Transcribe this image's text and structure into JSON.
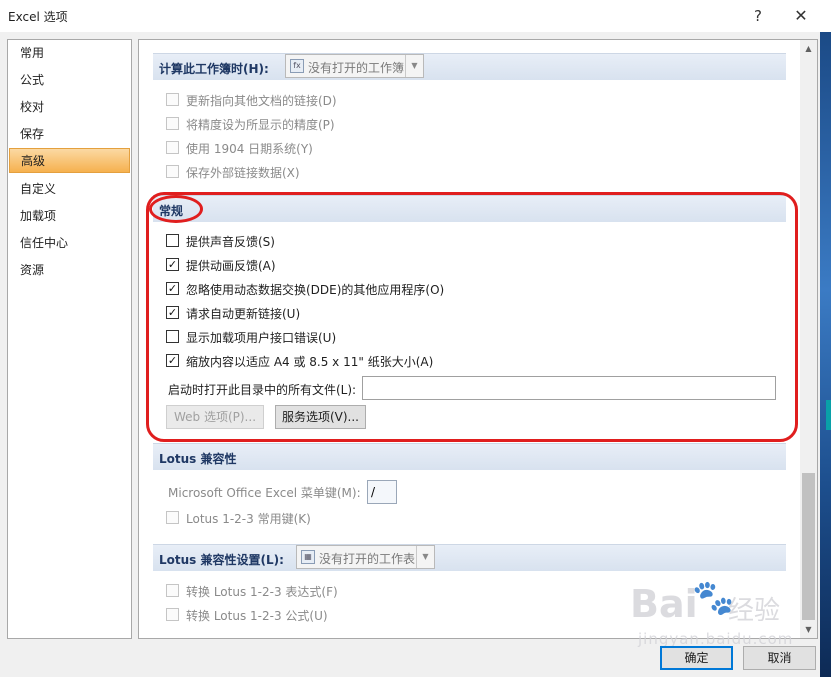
{
  "window": {
    "title": "Excel 选项",
    "help_glyph": "?",
    "close_glyph": "✕"
  },
  "nav": {
    "items": [
      {
        "label": "常用"
      },
      {
        "label": "公式"
      },
      {
        "label": "校对"
      },
      {
        "label": "保存"
      },
      {
        "label": "高级",
        "active": true
      },
      {
        "label": "自定义"
      },
      {
        "label": "加载项"
      },
      {
        "label": "信任中心"
      },
      {
        "label": "资源"
      }
    ]
  },
  "calc_section": {
    "title": "计算此工作簿时(H):",
    "dropdown_value": "没有打开的工作簿",
    "options": [
      {
        "label": "更新指向其他文档的链接(D)",
        "checked": false,
        "enabled": false
      },
      {
        "label": "将精度设为所显示的精度(P)",
        "checked": false,
        "enabled": false
      },
      {
        "label": "使用 1904 日期系统(Y)",
        "checked": false,
        "enabled": false
      },
      {
        "label": "保存外部链接数据(X)",
        "checked": false,
        "enabled": false
      }
    ]
  },
  "general_section": {
    "title": "常规",
    "options": [
      {
        "label": "提供声音反馈(S)",
        "checked": false,
        "enabled": true
      },
      {
        "label": "提供动画反馈(A)",
        "checked": true,
        "enabled": true
      },
      {
        "label": "忽略使用动态数据交换(DDE)的其他应用程序(O)",
        "checked": true,
        "enabled": true
      },
      {
        "label": "请求自动更新链接(U)",
        "checked": true,
        "enabled": true
      },
      {
        "label": "显示加载项用户接口错误(U)",
        "checked": false,
        "enabled": true
      },
      {
        "label": "缩放内容以适应 A4 或 8.5 x 11\" 纸张大小(A)",
        "checked": true,
        "enabled": true
      }
    ],
    "startup_label": "启动时打开此目录中的所有文件(L):",
    "startup_value": "",
    "web_options_button": "Web 选项(P)...",
    "service_options_button": "服务选项(V)..."
  },
  "lotus_section": {
    "title": "Lotus 兼容性",
    "menu_key_label": "Microsoft Office Excel 菜单键(M):",
    "menu_key_value": "/",
    "nav_keys_label": "Lotus 1-2-3 常用键(K)"
  },
  "lotus_settings_section": {
    "title": "Lotus 兼容性设置(L):",
    "dropdown_value": "没有打开的工作表",
    "options": [
      {
        "label": "转换 Lotus 1-2-3 表达式(F)",
        "checked": false,
        "enabled": false
      },
      {
        "label": "转换 Lotus 1-2-3 公式(U)",
        "checked": false,
        "enabled": false
      }
    ]
  },
  "footer": {
    "ok_label": "确定",
    "cancel_label": "取消"
  },
  "watermark": {
    "brand": "Bai",
    "cn": "经验",
    "url": "jingyan.baidu.com"
  },
  "glyphs": {
    "check": "✓",
    "arrow_up": "▲",
    "arrow_down": "▼",
    "dropdown_arrow": "▼",
    "paw": "🐾"
  },
  "colors": {
    "annotation_red": "#e01e1e",
    "nav_active": "#f6b14f",
    "section_header": "#dce5f0",
    "primary_border": "#0078d7"
  }
}
